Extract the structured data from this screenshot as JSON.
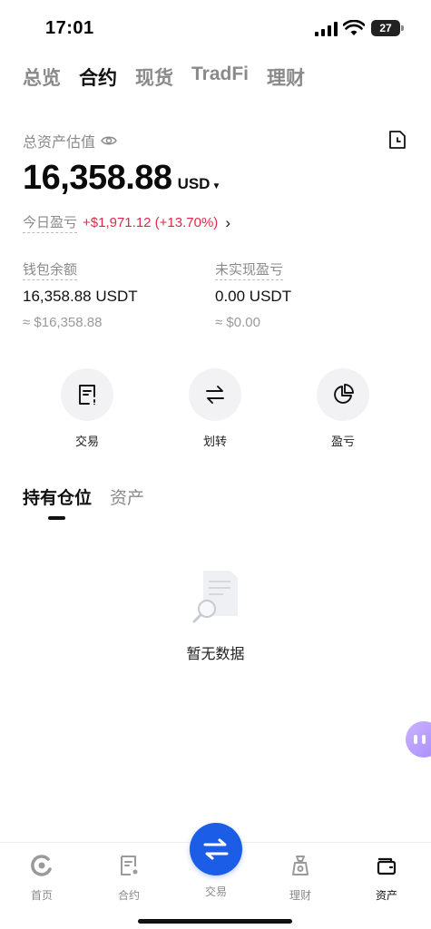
{
  "status_bar": {
    "time": "17:01",
    "battery": "27"
  },
  "top_tabs": [
    {
      "label": "总览",
      "active": false
    },
    {
      "label": "合约",
      "active": true
    },
    {
      "label": "现货",
      "active": false
    },
    {
      "label": "TradFi",
      "active": false
    },
    {
      "label": "理财",
      "active": false
    }
  ],
  "overview": {
    "label": "总资产估值",
    "total": "16,358.88",
    "currency": "USD",
    "pnl_label": "今日盈亏",
    "pnl_value": "+$1,971.12 (+13.70%)"
  },
  "stats": {
    "wallet": {
      "label": "钱包余额",
      "value": "16,358.88 USDT",
      "sub": "≈ $16,358.88"
    },
    "unrealized": {
      "label": "未实现盈亏",
      "value": "0.00 USDT",
      "sub": "≈ $0.00"
    }
  },
  "actions": [
    {
      "label": "交易",
      "icon": "trade-doc-icon"
    },
    {
      "label": "划转",
      "icon": "transfer-icon"
    },
    {
      "label": "盈亏",
      "icon": "pie-chart-icon"
    }
  ],
  "position_tabs": [
    {
      "label": "持有仓位",
      "active": true
    },
    {
      "label": "资产",
      "active": false
    }
  ],
  "empty_state": {
    "text": "暂无数据"
  },
  "bottom_nav": [
    {
      "label": "首页",
      "icon": "home-icon"
    },
    {
      "label": "合约",
      "icon": "contract-icon"
    },
    {
      "label": "交易",
      "icon": "swap-icon"
    },
    {
      "label": "理财",
      "icon": "earn-icon"
    },
    {
      "label": "资产",
      "icon": "wallet-icon",
      "active": true
    }
  ],
  "colors": {
    "accent": "#1b5de6",
    "profit": "#e0294a"
  }
}
